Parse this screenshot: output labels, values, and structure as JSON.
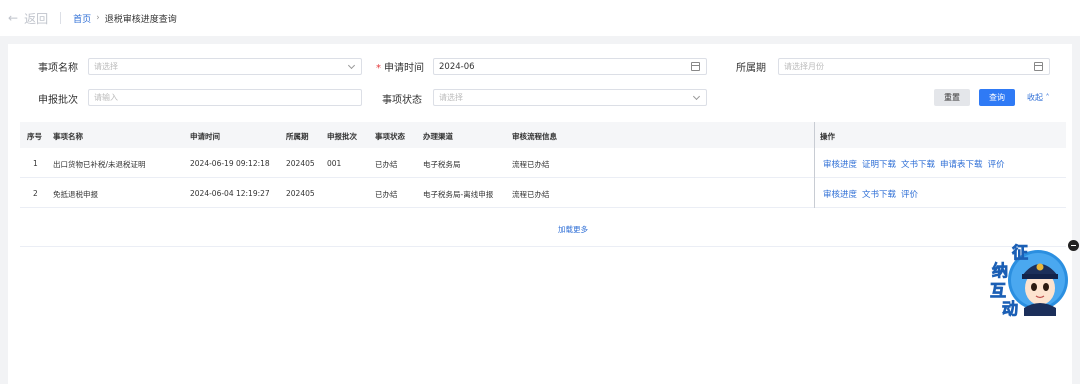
{
  "header": {
    "back_label": "返回",
    "breadcrumb_home": "首页",
    "breadcrumb_separator": "›",
    "breadcrumb_current": "退税审核进度查询"
  },
  "form": {
    "item_name_label": "事项名称",
    "item_name_placeholder": "请选择",
    "apply_time_required_mark": "*",
    "apply_time_label": "申请时间",
    "apply_time_value": "2024-06",
    "period_label": "所属期",
    "period_placeholder": "请选择月份",
    "batch_label": "申报批次",
    "batch_placeholder": "请输入",
    "status_label": "事项状态",
    "status_placeholder": "请选择",
    "reset_label": "重置",
    "query_label": "查询",
    "collapse_label": "收起",
    "collapse_icon": "chevron-up-icon"
  },
  "table": {
    "headers": {
      "index": "序号",
      "name": "事项名称",
      "time": "申请时间",
      "period": "所属期",
      "batch": "申报批次",
      "status": "事项状态",
      "channel": "办理渠道",
      "flow": "审核流程信息",
      "ops": "操作"
    },
    "rows": [
      {
        "index": "1",
        "name": "出口货物已补税/未退税证明",
        "time": "2024-06-19 09:12:18",
        "period": "202405",
        "batch": "001",
        "status": "已办结",
        "channel": "电子税务局",
        "flow": "流程已办结",
        "ops": [
          "审核进度",
          "证明下载",
          "文书下载",
          "申请表下载",
          "评价"
        ]
      },
      {
        "index": "2",
        "name": "免抵退税申报",
        "time": "2024-06-04 12:19:27",
        "period": "202405",
        "batch": "",
        "status": "已办结",
        "channel": "电子税务局-离线申报",
        "flow": "流程已办结",
        "ops": [
          "审核进度",
          "文书下载",
          "评价"
        ]
      }
    ],
    "load_more": "加载更多"
  },
  "widget": {
    "char1": "征",
    "char2": "纳",
    "char3": "互",
    "char4": "动"
  }
}
